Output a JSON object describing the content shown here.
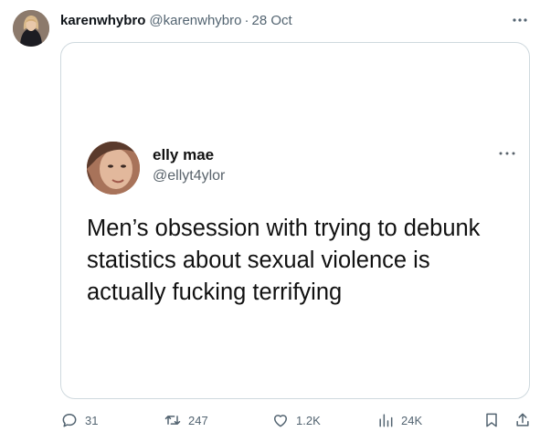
{
  "tweet": {
    "author_name": "karenwhybro",
    "author_handle": "@karenwhybro",
    "separator": "·",
    "time": "28 Oct",
    "more_icon": "more-horizontal-icon"
  },
  "media": {
    "inner_name": "elly mae",
    "inner_handle": "@ellyt4ylor",
    "inner_text": "Men’s obsession with trying to debunk\nstatistics about sexual violence is\nactually fucking terrifying",
    "more_icon": "more-horizontal-icon"
  },
  "actions": {
    "replies": "31",
    "reposts": "247",
    "likes": "1.2K",
    "views": "24K",
    "icons": [
      "reply-icon",
      "repost-icon",
      "like-icon",
      "views-icon",
      "bookmark-icon",
      "share-icon"
    ]
  },
  "colors": {
    "text_primary": "#0f1419",
    "text_secondary": "#536471",
    "border": "#cfd9de"
  }
}
